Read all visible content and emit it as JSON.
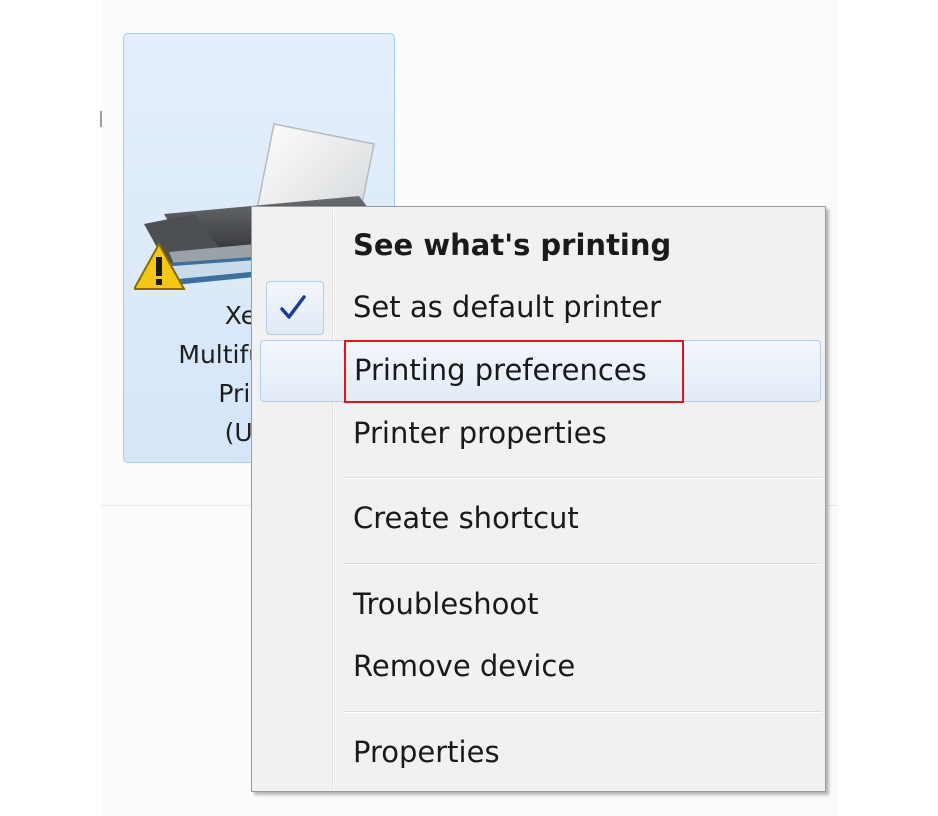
{
  "device": {
    "label_lines": [
      "Xerox",
      "Multifunction",
      "Printer",
      "(USB)"
    ]
  },
  "context_menu": {
    "items": [
      {
        "label": "See what's printing",
        "bold": true
      },
      {
        "label": "Set as default printer",
        "checked": true
      },
      {
        "label": "Printing preferences",
        "hovered": true,
        "annotated": true
      },
      {
        "label": "Printer properties"
      },
      {
        "label": "Create shortcut"
      },
      {
        "label": "Troubleshoot"
      },
      {
        "label": "Remove device"
      },
      {
        "label": "Properties"
      }
    ]
  },
  "colors": {
    "selection_fill": "#d5e6f8",
    "check_mark": "#1a3a9e",
    "annotation_border": "#e8111a",
    "warning_yellow": "#f5c518"
  },
  "icons": {
    "device": "printer-icon",
    "warning": "warning-icon",
    "default": "check-icon"
  }
}
